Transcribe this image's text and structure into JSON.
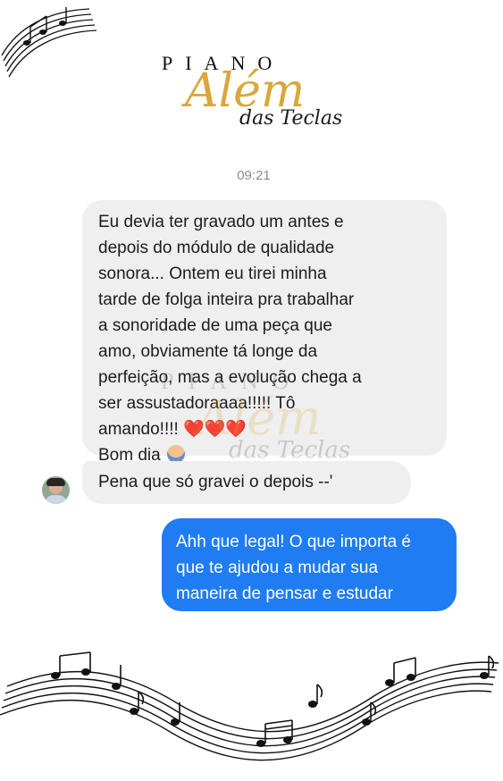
{
  "brand": {
    "piano": "PIANO",
    "alem": "Além",
    "das_teclas": "das Teclas"
  },
  "chat": {
    "time": "09:21",
    "received_message_1": {
      "lines": [
        "Eu devia ter gravado um antes e",
        "depois do módulo de qualidade",
        "sonora... Ontem eu tirei minha",
        "tarde de folga inteira pra trabalhar",
        "a sonoridade de uma peça que",
        "amo, obviamente tá longe da",
        "perfeição, mas a evolução chega a",
        "ser assustadoraaaa!!!!! Tô",
        "amando!!!!"
      ],
      "hearts": "❤️❤️❤️",
      "closing": "Bom dia"
    },
    "received_message_2": "Pena que só gravei o depois --'",
    "sent_message": {
      "lines": [
        "Ahh que legal! O que importa é",
        "que te ajudou a mudar sua",
        "maneira de pensar e estudar"
      ]
    }
  },
  "colors": {
    "sent_bubble": "#1f7cf2",
    "received_bubble": "#efefef",
    "brand_gold": "#d9a73a"
  }
}
